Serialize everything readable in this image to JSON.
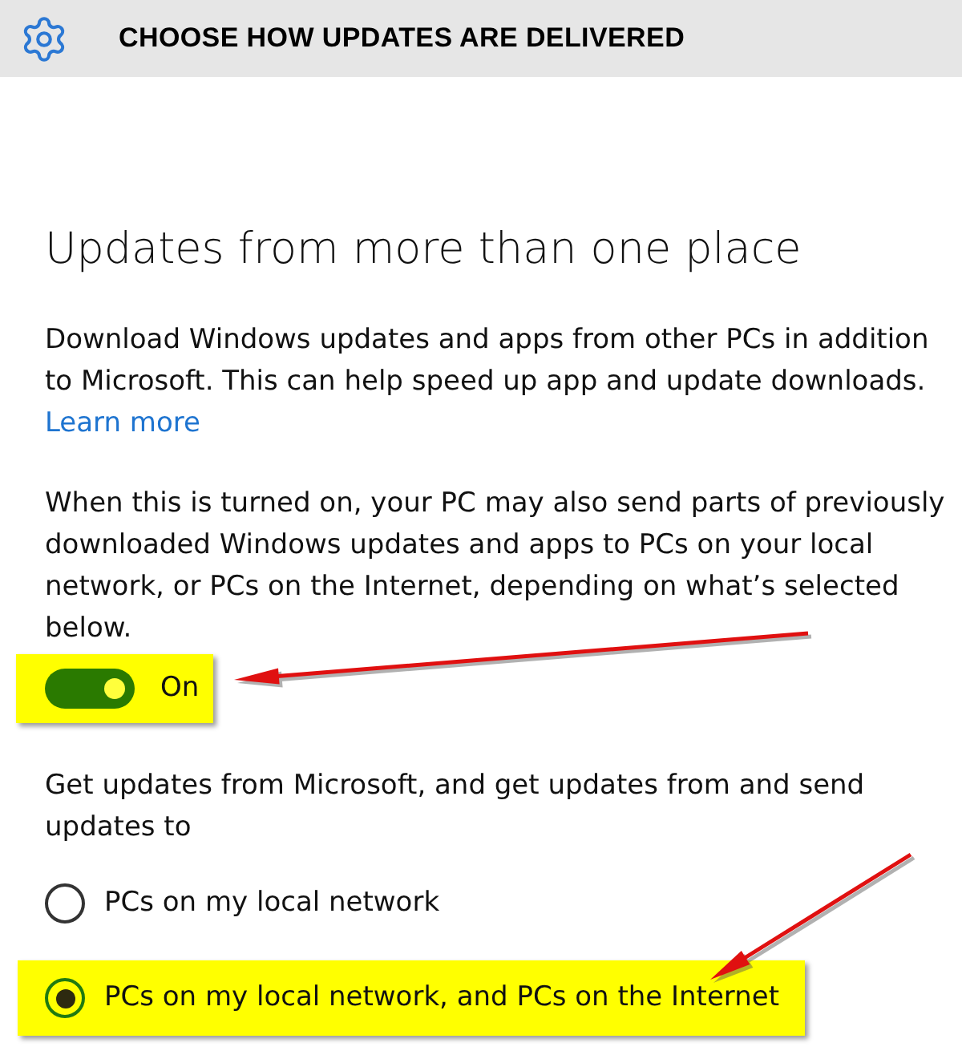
{
  "header": {
    "title": "CHOOSE HOW UPDATES ARE DELIVERED"
  },
  "section": {
    "heading": "Updates from more than one place",
    "description": "Download Windows updates and apps from other PCs in addition to Microsoft. This can help speed up app and update downloads.",
    "link": "Learn more",
    "note": "When this is turned on, your PC may also send parts of previously downloaded Windows updates and apps to PCs on your local network, or PCs on the Internet, depending on what’s selected below.",
    "toggle": {
      "on": true,
      "label": "On",
      "highlighted": true
    },
    "options_label": "Get updates from Microsoft, and get updates from and send updates to",
    "options": [
      {
        "label": "PCs on my local network",
        "selected": false,
        "highlighted": false
      },
      {
        "label": "PCs on my local network, and PCs on the Internet",
        "selected": true,
        "highlighted": true
      }
    ]
  }
}
